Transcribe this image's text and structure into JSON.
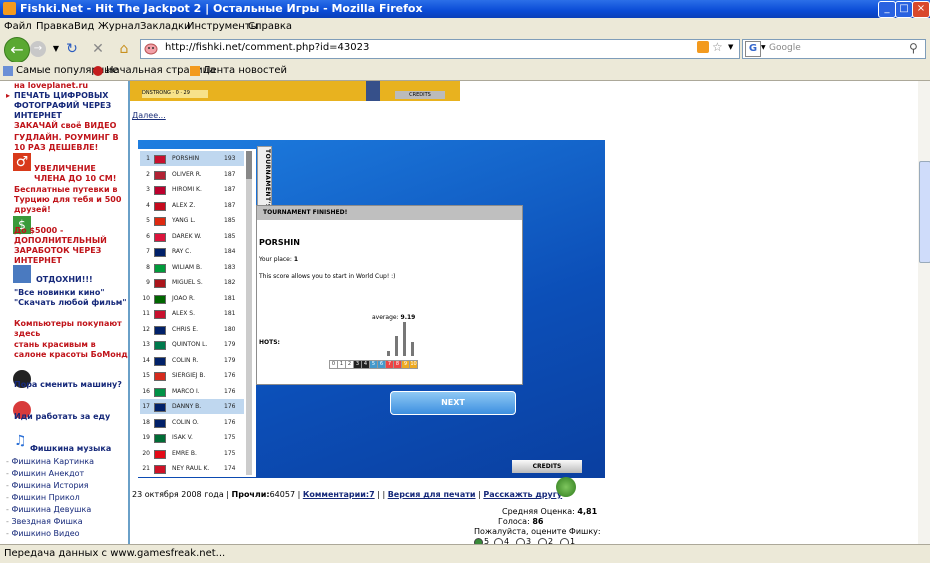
{
  "window": {
    "title": "Fishki.Net - Hit The Jackpot 2 | Остальные Игры - Mozilla Firefox",
    "controls": [
      "_",
      "□",
      "×"
    ]
  },
  "menu": [
    "Файл",
    "Правка",
    "Вид",
    "Журнал",
    "Закладки",
    "Инструменты",
    "Справка"
  ],
  "nav": {
    "url": "http://fishki.net/comment.php?id=43023",
    "search_placeholder": "Google",
    "search_engine_label": "G"
  },
  "bookmarks": [
    "Самые популярные",
    "Начальная страница",
    "Лента новостей"
  ],
  "sidebar": {
    "top_fragment": "на loveplanet.ru",
    "links": [
      {
        "text": "ПЕЧАТЬ ЦИФРОВЫХ ФОТОГРАФИЙ ЧЕРЕЗ ИНТЕРНЕТ"
      },
      {
        "text": "ЗАКАЧАЙ своё ВИДЕО"
      },
      {
        "text": "ГУДЛАЙН. РОУМИНГ В 10 РАЗ ДЕШЕВЛЕ!"
      },
      {
        "text": "УВЕЛИЧЕНИЕ ЧЛЕНА ДО 10 СМ!"
      },
      {
        "text": "Бесплатные путевки в Турцию для тебя и 500 друзей!"
      },
      {
        "text": "До $5000 - ДОПОЛНИТЕЛЬНЫЙ ЗАРАБОТОК ЧЕРЕЗ ИНТЕРНЕТ"
      },
      {
        "text": "ОТДОХНИ!!!"
      },
      {
        "text": "\"Все новинки кино\" \"Скачать любой фильм\""
      },
      {
        "text": "Компьютеры покупают здесь"
      },
      {
        "text": "стань красивым в салоне красоты БоМонд"
      },
      {
        "text": "Пора сменить машину?"
      },
      {
        "text": "Иди работать за еду"
      },
      {
        "text": "Фишкина музыка"
      }
    ],
    "categories": [
      "Фишкина Картинка",
      "Фишкин Анекдот",
      "Фишкина История",
      "Фишкин Прикол",
      "Фишкина Девушка",
      "Звездная Фишка",
      "Фишкино Видео"
    ]
  },
  "banner": {
    "strip_text": "DNSTRONG · 0 · 29",
    "credits_label": "CREDITS"
  },
  "dalee": "Далее...",
  "game": {
    "tab_label": "TOURNAMENT'S RANK",
    "rankings": [
      {
        "n": "1",
        "name": "PORSHIN",
        "score": "193",
        "flag": "#c8102e"
      },
      {
        "n": "2",
        "name": "OLIVER R.",
        "score": "187",
        "flag": "#b22234"
      },
      {
        "n": "3",
        "name": "HIROMI K.",
        "score": "187",
        "flag": "#bc002d"
      },
      {
        "n": "4",
        "name": "ALEX Z.",
        "score": "187",
        "flag": "#c60b1e"
      },
      {
        "n": "5",
        "name": "YANG L.",
        "score": "185",
        "flag": "#de2910"
      },
      {
        "n": "6",
        "name": "DAREK W.",
        "score": "185",
        "flag": "#dc143c"
      },
      {
        "n": "7",
        "name": "RAY C.",
        "score": "184",
        "flag": "#012169"
      },
      {
        "n": "8",
        "name": "WILIAM B.",
        "score": "183",
        "flag": "#009b3a"
      },
      {
        "n": "9",
        "name": "MIGUEL S.",
        "score": "182",
        "flag": "#aa151b"
      },
      {
        "n": "10",
        "name": "JOAO R.",
        "score": "181",
        "flag": "#006600"
      },
      {
        "n": "11",
        "name": "ALEX S.",
        "score": "181",
        "flag": "#c8102e"
      },
      {
        "n": "12",
        "name": "CHRIS E.",
        "score": "180",
        "flag": "#012169"
      },
      {
        "n": "13",
        "name": "QUINTON L.",
        "score": "179",
        "flag": "#007a4d"
      },
      {
        "n": "14",
        "name": "COLIN R.",
        "score": "179",
        "flag": "#012169"
      },
      {
        "n": "15",
        "name": "SIERGIEJ B.",
        "score": "176",
        "flag": "#d52b1e"
      },
      {
        "n": "16",
        "name": "MARCO I.",
        "score": "176",
        "flag": "#009246"
      },
      {
        "n": "17",
        "name": "DANNY B.",
        "score": "176",
        "flag": "#012169"
      },
      {
        "n": "18",
        "name": "COLIN O.",
        "score": "176",
        "flag": "#012169"
      },
      {
        "n": "19",
        "name": "ISAK V.",
        "score": "175",
        "flag": "#006c35"
      },
      {
        "n": "20",
        "name": "EMRE B.",
        "score": "175",
        "flag": "#e30a17"
      },
      {
        "n": "21",
        "name": "NEY RAUL K.",
        "score": "174",
        "flag": "#ce1126"
      }
    ],
    "panel": {
      "header": "TOURNAMENT FINISHED!",
      "player": "PORSHIN",
      "place_label": "Your place:",
      "place_value": "1",
      "message": "This score allows you to start in World Cup! :)",
      "average_label": "average:",
      "average_value": "9.19",
      "shots_label": "HOTS:",
      "histogram": [
        0,
        0,
        0,
        0,
        0,
        0,
        0,
        0.15,
        0.6,
        1.0,
        0.4
      ],
      "histogram_labels": [
        "0",
        "1",
        "2",
        "3",
        "4",
        "5",
        "6",
        "7",
        "8",
        "9",
        "10"
      ]
    },
    "next_label": "NEXT",
    "credits_label": "CREDITS"
  },
  "meta": {
    "date": "23 октября 2008 года",
    "views_label": "Прочли:",
    "views_value": "64057",
    "comments_label": "Комментарии:",
    "comments_value": "7",
    "print_label": "Версия для печати",
    "tell_label": "Расскажть другу"
  },
  "rating": {
    "avg_label": "Средняя Оценка:",
    "avg_value": "4,81",
    "votes_label": "Голоса:",
    "votes_value": "86",
    "prompt": "Пожалуйста, оцените Фишку:",
    "options": [
      "5",
      "4",
      "3",
      "2",
      "1"
    ]
  },
  "status": "Передача данных с www.gamesfreak.net..."
}
